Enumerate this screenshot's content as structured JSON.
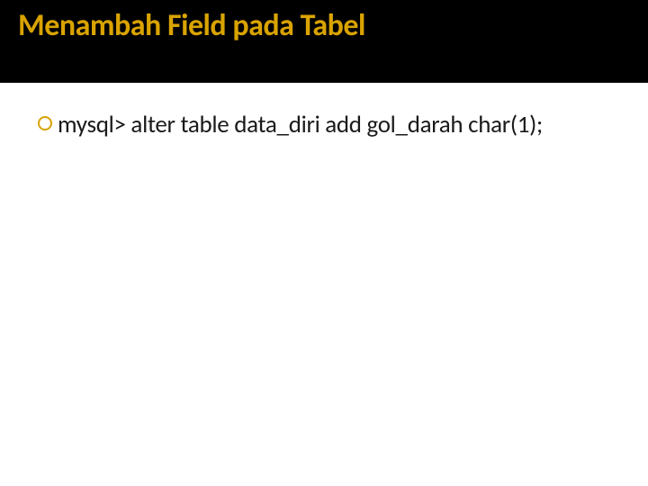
{
  "slide": {
    "title": "Menambah Field pada Tabel",
    "bullets": [
      {
        "text": "mysql> alter table data_diri add gol_darah char(1);"
      }
    ]
  },
  "colors": {
    "title": "#d9a300",
    "titleBg": "#000000",
    "bulletStroke": "#d9a300",
    "bodyText": "#1a1a1a"
  }
}
